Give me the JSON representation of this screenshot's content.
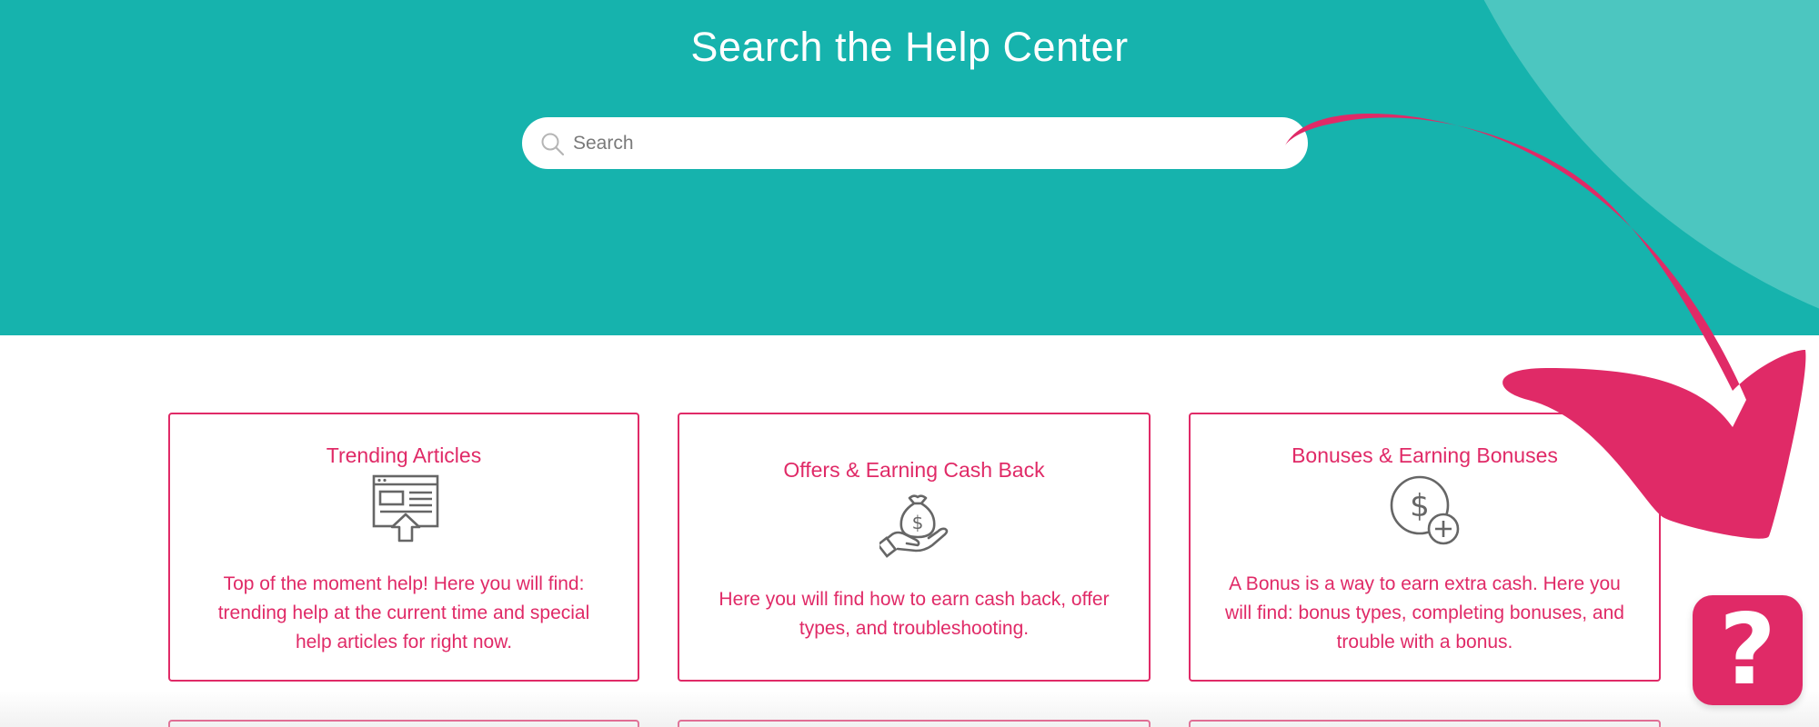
{
  "header": {
    "title": "Search the Help Center"
  },
  "search": {
    "placeholder": "Search"
  },
  "cards": [
    {
      "title": "Trending Articles",
      "icon": "browser-upload-icon",
      "description": "Top of the moment help! Here you will find: trending help at the current time and special help articles for right now."
    },
    {
      "title": "Offers & Earning Cash Back",
      "icon": "money-bag-hand-icon",
      "description": "Here you will find how to earn cash back, offer types, and troubleshooting."
    },
    {
      "title": "Bonuses & Earning Bonuses",
      "icon": "dollar-plus-icon",
      "description": "A Bonus is a way to earn extra cash. Here you will find: bonus types, completing bonuses, and trouble with a bonus."
    }
  ],
  "help_button": {
    "label": "?"
  },
  "colors": {
    "hero_teal": "#16b3ad",
    "hero_arc": "#4cc6c0",
    "accent_pink": "#e02a67",
    "icon_gray": "#666666"
  }
}
